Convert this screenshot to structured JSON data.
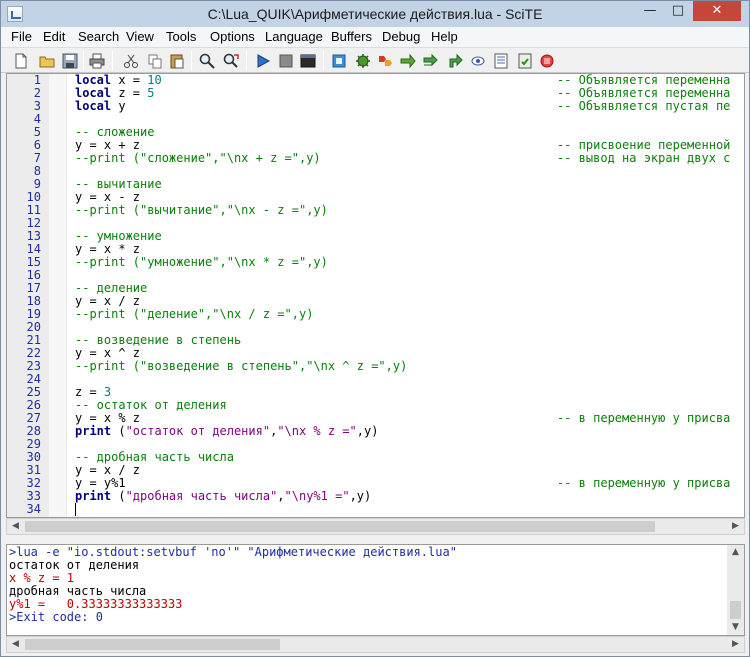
{
  "window": {
    "title": "C:\\Lua_QUIK\\Арифметические действия.lua - SciTE",
    "min_glyph": "—",
    "max_glyph": "□",
    "close_glyph": "✕"
  },
  "menu": [
    "File",
    "Edit",
    "Search",
    "View",
    "Tools",
    "Options",
    "Language",
    "Buffers",
    "Debug",
    "Help"
  ],
  "toolbar_icons": [
    "new-file-icon",
    "open-file-icon",
    "save-icon",
    "print-icon",
    "cut-icon",
    "copy-icon",
    "paste-icon",
    "find-icon",
    "replace-icon",
    "run-icon",
    "stop-icon",
    "console-icon",
    "plugin-1-icon",
    "plugin-2-icon",
    "plugin-3-icon",
    "plugin-4-icon",
    "plugin-5-icon",
    "plugin-6-icon",
    "plugin-7-icon",
    "plugin-8-icon",
    "plugin-9-icon",
    "plugin-10-icon"
  ],
  "editor": {
    "lines": [
      {
        "n": "1",
        "code": "local x = 10",
        "comment": "-- Объявляется переменна"
      },
      {
        "n": "2",
        "code": "local z = 5",
        "comment": "-- Объявляется переменна"
      },
      {
        "n": "3",
        "code": "local y",
        "comment": "-- Объявляется пустая пе"
      },
      {
        "n": "4",
        "code": "",
        "comment": ""
      },
      {
        "n": "5",
        "code": "-- сложение",
        "comment": ""
      },
      {
        "n": "6",
        "code": "y = x + z",
        "comment": "-- присвоение переменной"
      },
      {
        "n": "7",
        "code": "--print (\"сложение\",\"\\nx + z =\",y)",
        "comment": "-- вывод на экран двух с"
      },
      {
        "n": "8",
        "code": "",
        "comment": ""
      },
      {
        "n": "9",
        "code": "-- вычитание",
        "comment": ""
      },
      {
        "n": "10",
        "code": "y = x - z",
        "comment": ""
      },
      {
        "n": "11",
        "code": "--print (\"вычитание\",\"\\nx - z =\",y)",
        "comment": ""
      },
      {
        "n": "12",
        "code": "",
        "comment": ""
      },
      {
        "n": "13",
        "code": "-- умножение",
        "comment": ""
      },
      {
        "n": "14",
        "code": "y = x * z",
        "comment": ""
      },
      {
        "n": "15",
        "code": "--print (\"умножение\",\"\\nx * z =\",y)",
        "comment": ""
      },
      {
        "n": "16",
        "code": "",
        "comment": ""
      },
      {
        "n": "17",
        "code": "-- деление",
        "comment": ""
      },
      {
        "n": "18",
        "code": "y = x / z",
        "comment": ""
      },
      {
        "n": "19",
        "code": "--print (\"деление\",\"\\nx / z =\",y)",
        "comment": ""
      },
      {
        "n": "20",
        "code": "",
        "comment": ""
      },
      {
        "n": "21",
        "code": "-- возведение в степень",
        "comment": ""
      },
      {
        "n": "22",
        "code": "y = x ^ z",
        "comment": ""
      },
      {
        "n": "23",
        "code": "--print (\"возведение в степень\",\"\\nx ^ z =\",y)",
        "comment": ""
      },
      {
        "n": "24",
        "code": "",
        "comment": ""
      },
      {
        "n": "25",
        "code": "z = 3",
        "comment": ""
      },
      {
        "n": "26",
        "code": "-- остаток от деления",
        "comment": ""
      },
      {
        "n": "27",
        "code": "y = x % z",
        "comment": "-- в переменную y присва"
      },
      {
        "n": "28",
        "code": "print (\"остаток от деления\",\"\\nx % z =\",y)",
        "comment": ""
      },
      {
        "n": "29",
        "code": "",
        "comment": ""
      },
      {
        "n": "30",
        "code": "-- дробная часть числа",
        "comment": ""
      },
      {
        "n": "31",
        "code": "y = x / z",
        "comment": ""
      },
      {
        "n": "32",
        "code": "y = y%1",
        "comment": "-- в переменную y присва"
      },
      {
        "n": "33",
        "code": "print (\"дробная часть числа\",\"\\ny%1 =\",y)",
        "comment": ""
      },
      {
        "n": "34",
        "code": "",
        "comment": ""
      }
    ]
  },
  "output": {
    "lines": [
      {
        "text": ">lua -e \"io.stdout:setvbuf 'no'\" \"Арифметические действия.lua\"",
        "color": "#1f2f9d"
      },
      {
        "text": "остаток от деления",
        "color": "#000000"
      },
      {
        "text": "x % z = 1",
        "color": "#c00000"
      },
      {
        "text": "дробная часть числа",
        "color": "#000000"
      },
      {
        "text": "y%1 =   0.33333333333333",
        "color": "#c00000"
      },
      {
        "text": ">Exit code: 0",
        "color": "#1f2f9d"
      }
    ]
  },
  "colors": {
    "keyword": "#00007f",
    "number": "#007f7f",
    "string": "#7f007f",
    "comment": "#0a7f0a",
    "line_number": "#1f2f9d"
  }
}
